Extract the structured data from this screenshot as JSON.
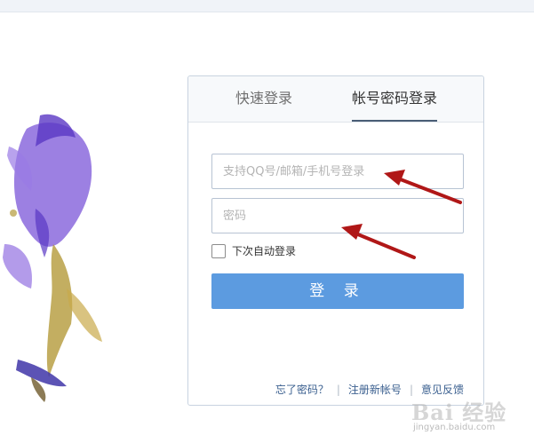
{
  "tabs": {
    "quick_login": "快速登录",
    "account_login": "帐号密码登录"
  },
  "form": {
    "username_placeholder": "支持QQ号/邮箱/手机号登录",
    "password_placeholder": "密码",
    "remember_label": "下次自动登录",
    "login_button": "登 录"
  },
  "footer": {
    "forgot_password": "忘了密码？",
    "register": "注册新帐号",
    "feedback": "意见反馈"
  },
  "watermark": {
    "logo": "Bai 经验",
    "url": "jingyan.baidu.com"
  },
  "colors": {
    "accent_button": "#5c9be0",
    "arrow": "#b01717",
    "link": "#3a5f8f"
  }
}
